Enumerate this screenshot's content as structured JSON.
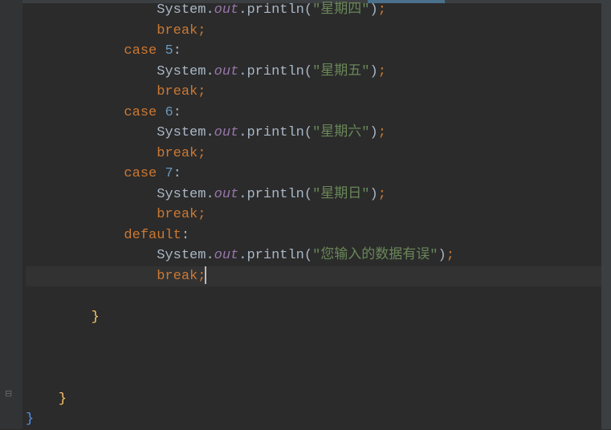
{
  "lines": [
    {
      "indent": "                ",
      "kind": "print",
      "cls": "System.",
      "field": "out",
      "dot": ".",
      "method": "println",
      "open": "(",
      "str": "\"星期四\"",
      "close": ")",
      "semi": ";"
    },
    {
      "indent": "                ",
      "kind": "break",
      "kw": "break",
      "semi": ";"
    },
    {
      "indent": "            ",
      "kind": "case",
      "kw": "case",
      "num": "5",
      "colon": ":"
    },
    {
      "indent": "                ",
      "kind": "print",
      "cls": "System.",
      "field": "out",
      "dot": ".",
      "method": "println",
      "open": "(",
      "str": "\"星期五\"",
      "close": ")",
      "semi": ";"
    },
    {
      "indent": "                ",
      "kind": "break",
      "kw": "break",
      "semi": ";"
    },
    {
      "indent": "            ",
      "kind": "case",
      "kw": "case",
      "num": "6",
      "colon": ":"
    },
    {
      "indent": "                ",
      "kind": "print",
      "cls": "System.",
      "field": "out",
      "dot": ".",
      "method": "println",
      "open": "(",
      "str": "\"星期六\"",
      "close": ")",
      "semi": ";"
    },
    {
      "indent": "                ",
      "kind": "break",
      "kw": "break",
      "semi": ";"
    },
    {
      "indent": "            ",
      "kind": "case",
      "kw": "case",
      "num": "7",
      "colon": ":"
    },
    {
      "indent": "                ",
      "kind": "print",
      "cls": "System.",
      "field": "out",
      "dot": ".",
      "method": "println",
      "open": "(",
      "str": "\"星期日\"",
      "close": ")",
      "semi": ";"
    },
    {
      "indent": "                ",
      "kind": "break",
      "kw": "break",
      "semi": ";"
    },
    {
      "indent": "            ",
      "kind": "default",
      "kw": "default",
      "colon": ":"
    },
    {
      "indent": "                ",
      "kind": "print",
      "cls": "System.",
      "field": "out",
      "dot": ".",
      "method": "println",
      "open": "(",
      "str": "\"您输入的数据有误\"",
      "close": ")",
      "semi": ";"
    },
    {
      "indent": "                ",
      "kind": "break-caret",
      "kw": "break",
      "semi": ";"
    },
    {
      "indent": "",
      "kind": "blank"
    },
    {
      "indent": "        ",
      "kind": "brace",
      "brace": "}",
      "cls": "brace-y"
    },
    {
      "indent": "",
      "kind": "blank"
    },
    {
      "indent": "",
      "kind": "blank"
    },
    {
      "indent": "",
      "kind": "blank"
    },
    {
      "indent": "    ",
      "kind": "brace",
      "brace": "}",
      "cls": "brace-y"
    },
    {
      "indent": "",
      "kind": "brace",
      "brace": "}",
      "cls": "brace-b"
    }
  ],
  "fold_icon": "⊟"
}
